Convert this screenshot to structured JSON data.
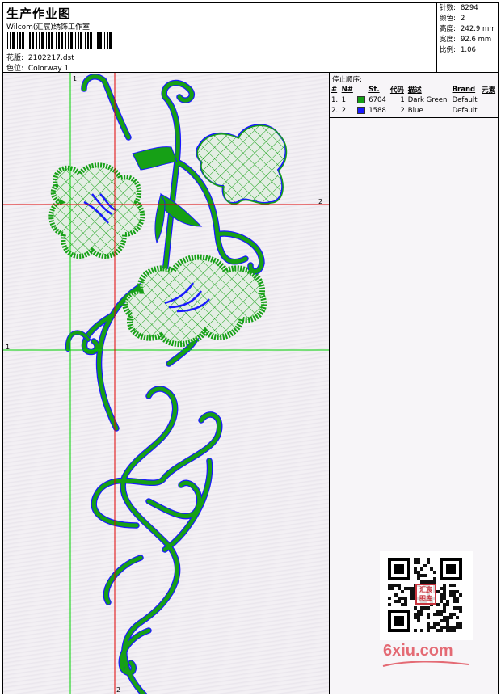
{
  "header": {
    "title": "生产作业图",
    "studio": "Wilcom(汇宸)绣饰工作室",
    "pattern_label": "花版:",
    "pattern_value": "2102217.dst",
    "colorway_label": "色位:",
    "colorway_value": "Colorway 1"
  },
  "stats": [
    {
      "label": "针数:",
      "value": "8294"
    },
    {
      "label": "颜色:",
      "value": "2"
    },
    {
      "label": "高度:",
      "value": "242.9 mm"
    },
    {
      "label": "宽度:",
      "value": "92.6 mm"
    },
    {
      "label": "比例:",
      "value": "1.06"
    }
  ],
  "guides": {
    "v1_label": "1",
    "h1_label": "1",
    "v2_label": "2",
    "h2_label": "2"
  },
  "colors": {
    "dark_green": "#16a016",
    "blue": "#1a1aff",
    "guide_green": "#00d000",
    "guide_red": "#e00000",
    "logo": "#e46a74"
  },
  "side_panel": {
    "stop_sequence_title": "停止顺序:",
    "columns": [
      "#",
      "N#",
      "St.",
      "代码",
      "描述",
      "Brand",
      "元素"
    ],
    "rows": [
      {
        "idx": "1.",
        "n": "1",
        "swatch": "#16a016",
        "st": "6704",
        "code": "1",
        "desc": "Dark Green",
        "brand": "Default"
      },
      {
        "idx": "2.",
        "n": "2",
        "swatch": "#1a1aff",
        "st": "1588",
        "code": "2",
        "desc": "Blue",
        "brand": "Default"
      }
    ]
  },
  "watermark": {
    "seal_text": "汇宸图库",
    "site": "6xiu.com"
  }
}
